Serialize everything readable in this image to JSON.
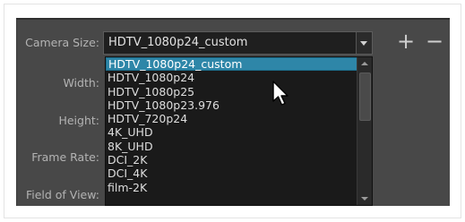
{
  "form": {
    "camera_size_label": "Camera Size:",
    "width_label": "Width:",
    "height_label": "Height:",
    "frame_rate_label": "Frame Rate:",
    "field_of_view_label": "Field of View:"
  },
  "camera_size": {
    "selected_value": "HDTV_1080p24_custom",
    "add_label": "+",
    "remove_label": "−"
  },
  "dropdown": {
    "options": [
      "HDTV_1080p24_custom",
      "HDTV_1080p24",
      "HDTV_1080p25",
      "HDTV_1080p23.976",
      "HDTV_720p24",
      "4K_UHD",
      "8K_UHD",
      "DCI_2K",
      "DCI_4K",
      "film-2K"
    ],
    "highlighted_index": 0
  },
  "colors": {
    "panel_bg": "#484848",
    "highlight": "#2e86a8",
    "list_bg": "#1a1a1a"
  }
}
